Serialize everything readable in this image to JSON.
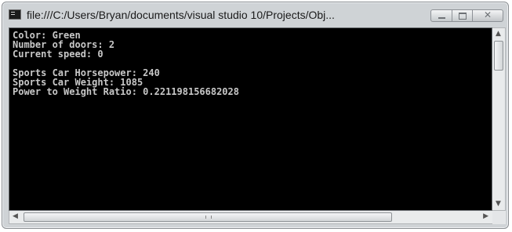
{
  "window": {
    "title": "file:///C:/Users/Bryan/documents/visual studio 10/Projects/Obj...",
    "close_glyph": "✕"
  },
  "console": {
    "lines": [
      "Color: Green",
      "Number of doors: 2",
      "Current speed: 0",
      "",
      "Sports Car Horsepower: 240",
      "Sports Car Weight: 1085",
      "Power to Weight Ratio: 0.221198156682028"
    ]
  },
  "scrollbars": {
    "up_arrow": "▲",
    "down_arrow": "▼",
    "left_arrow": "◀",
    "right_arrow": "▶"
  }
}
